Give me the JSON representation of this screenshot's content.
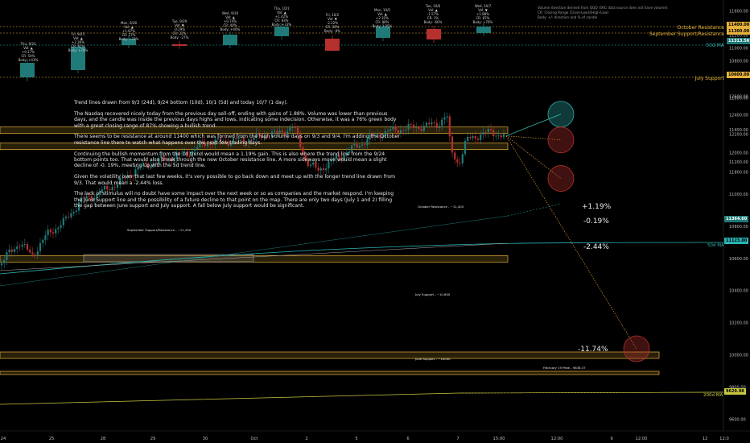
{
  "chart_data": {
    "type": "candlestick",
    "symbol": "Nasdaq",
    "price_range": [
      9300,
      11650
    ],
    "x_axis_labels": [
      "24",
      "25",
      "28",
      "29",
      "30",
      "Oct",
      "2",
      "5",
      "6",
      "7",
      "15:00",
      "12:00",
      "9",
      "12:00",
      "12",
      "12:0"
    ],
    "right_axis_ticks": [
      "11600.00",
      "11400.00",
      "11200.00",
      "11000.00",
      "10800.00",
      "10600.00",
      "10400.00",
      "10200.00",
      "10000.00",
      "9800.00",
      "9600.00",
      "9400.00"
    ],
    "right_axis_ticks_top": [
      "12600.00",
      "12400.00",
      "12200.00",
      "12000.00",
      "11800.00",
      "11600.00",
      "11400.00",
      "11200.00",
      "11000.00",
      "10800.00",
      "10600.00",
      "10400.00",
      "10200.00",
      "10000.00",
      "9800.00",
      "9600.00",
      "9400.00"
    ],
    "price_tags": {
      "current": "11364.60",
      "ma50": "11123.80",
      "ma200": "9629.98",
      "top_current": "11313.56",
      "top_oct_res": "11400.00",
      "top_sep_res": "11300.00",
      "top_july": "10600.00"
    },
    "levels": {
      "october_resistance": {
        "label": "October Resistance ~11,400",
        "value": 11400
      },
      "september_support": {
        "label": "September Support/Resistance ~11,300",
        "value": 11300
      },
      "july_support": {
        "label": "July Support ~10,600",
        "value": 10600
      },
      "june_support": {
        "label": "June Support ~10000",
        "value": 10000
      },
      "february_peak": {
        "label": "February 19 Peak - 9838.37",
        "value": 9838.37
      }
    },
    "projections": [
      {
        "label": "+1.19%",
        "value": 11500
      },
      {
        "label": "-0.19%",
        "value": 11340
      },
      {
        "label": "-2.44%",
        "value": 11100
      },
      {
        "label": "-11.74%",
        "value": 10040
      }
    ],
    "top_candles": [
      {
        "date": "Thu, 9/24",
        "change": "+0.17%",
        "cr": "CR: 54%",
        "body": "Body: +43%",
        "vol": "Vol: ▲"
      },
      {
        "date": "Fri, 9/25",
        "change": "+2.36%",
        "cr": "CR: 91%",
        "body": "Body: +78%",
        "vol": "Vol: ▲"
      },
      {
        "date": "Mon, 9/28",
        "change": "+1.87%",
        "cr": "CR: 57%",
        "body": "Body: +33%",
        "vol": "Vol: ▲"
      },
      {
        "date": "Tue, 9/29",
        "change": "-0.29%",
        "cr": "CR: 22%",
        "body": "Body: -27%",
        "vol": "Vol: ▼"
      },
      {
        "date": "Wed, 9/30",
        "change": "+0.74%",
        "cr": "CR: 40%",
        "body": "Body: +40%",
        "vol": "Vol: ▲"
      },
      {
        "date": "Thu, 10/1",
        "change": "+1.42%",
        "cr": "CR: 83%",
        "body": "Body: +33%",
        "vol": "Vol: ▲"
      },
      {
        "date": "Fri, 10/2",
        "change": "-2.22%",
        "cr": "CR: 30%",
        "body": "Body: -9%",
        "vol": "Vol: ▼"
      },
      {
        "date": "Mon, 10/5",
        "change": "+2.32%",
        "cr": "CR: 98%",
        "body": "Body: +95%",
        "vol": "Vol: ▲"
      },
      {
        "date": "Tue, 10/6",
        "change": "-1.57%",
        "cr": "CR: 1%",
        "body": "Body: -60%",
        "vol": "Vol: ▲"
      },
      {
        "date": "Wed, 10/7",
        "change": "+1.88%",
        "cr": "CR: 87%",
        "body": "Body: +76%",
        "vol": "Vol: ▼"
      }
    ]
  },
  "legend": {
    "line1": "Volume direction derived from QQQ (IXIC data source does not have volume).",
    "line2": "CR: Closing Range (Close-Low)/(High-Low)",
    "line3": "Body: +/- direction and % of candle"
  },
  "top_labels": {
    "october_resistance": "October Resistance",
    "september_support": "September Support/Resistance",
    "ma50": "50d MA",
    "july_support": "July Support"
  },
  "zone_labels": {
    "october": "October Resistance - ~11,400",
    "september": "September Support/Resistance - ~11,300",
    "july": "July Support - ~10,600",
    "june": "June Support - ~10000",
    "february": "February 19 Peak - 9838.37"
  },
  "ma_labels": {
    "ma50": "50d MA",
    "ma200": "200d MA"
  },
  "note": {
    "p1": "Trend lines drawn from 9/3 (24d), 9/24 bottom (10d), 10/1 (5d) and today 10/7 (1 day).",
    "p2": "The Nasdaq recovered nicely today from the previous day sell-off, ending with gains of 1.88%. Volume was lower than previous days, and the candle was inside the previous days highs and lows, indicating some indecision.  Otherwise, it was a 76% green body with a great closing range of 87% showing a bullish trend.",
    "p3": "There seems to be resistance at around 11400 which was formed from the high volume days on 9/3 and 9/4. I'm adding the October resistance line there to watch what happens over the next few trading days.",
    "p4": "Continuing the bullish momentum from the 1d trend would mean a 1.19% gain. This is also where the trend line from the 9/24 bottom points too. That would also break through the new October resistance line. A more sideways move would mean a slight decline of -0. 19%, meeting up with the 5d trend line.",
    "p5": "Given the volatility over that last few weeks, it's very possible to go back down and meet up with the longer trend line drawn from 9/3. That would mean a -2.44% loss.",
    "p6": "The lack of stimulus will no doubt have some impact over the next week or so as companies and the market respond. I'm keeping the June Support line and the possibility of a future decline to that point on the map.  There are only two days (July 1 and 2) filling the gap between June support and July support. A fall below July support would be significant."
  },
  "colors": {
    "background": "#000000",
    "up": "#1f7a78",
    "down": "#b5302e",
    "zone": "#e6b23a",
    "ma50": "#2ab3b3",
    "ma200": "#c8c840",
    "projection_up": "#2fa6a6",
    "projection_down": "#b5302e"
  }
}
